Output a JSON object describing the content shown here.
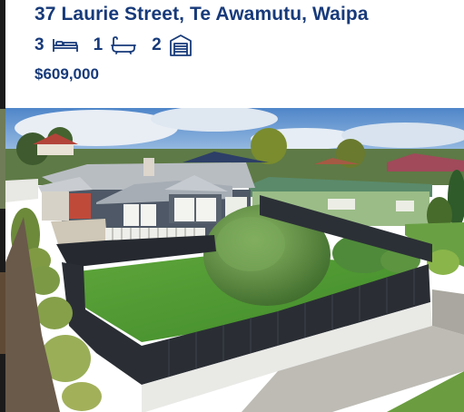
{
  "listing": {
    "address": "37 Laurie Street, Te Awamutu, Waipa",
    "bedrooms": "3",
    "bathrooms": "1",
    "garages": "2",
    "price": "$609,000"
  },
  "icons": {
    "bedroom": "bed-icon",
    "bathroom": "bath-icon",
    "garage": "garage-icon"
  },
  "colors": {
    "text_primary": "#173a7a"
  }
}
